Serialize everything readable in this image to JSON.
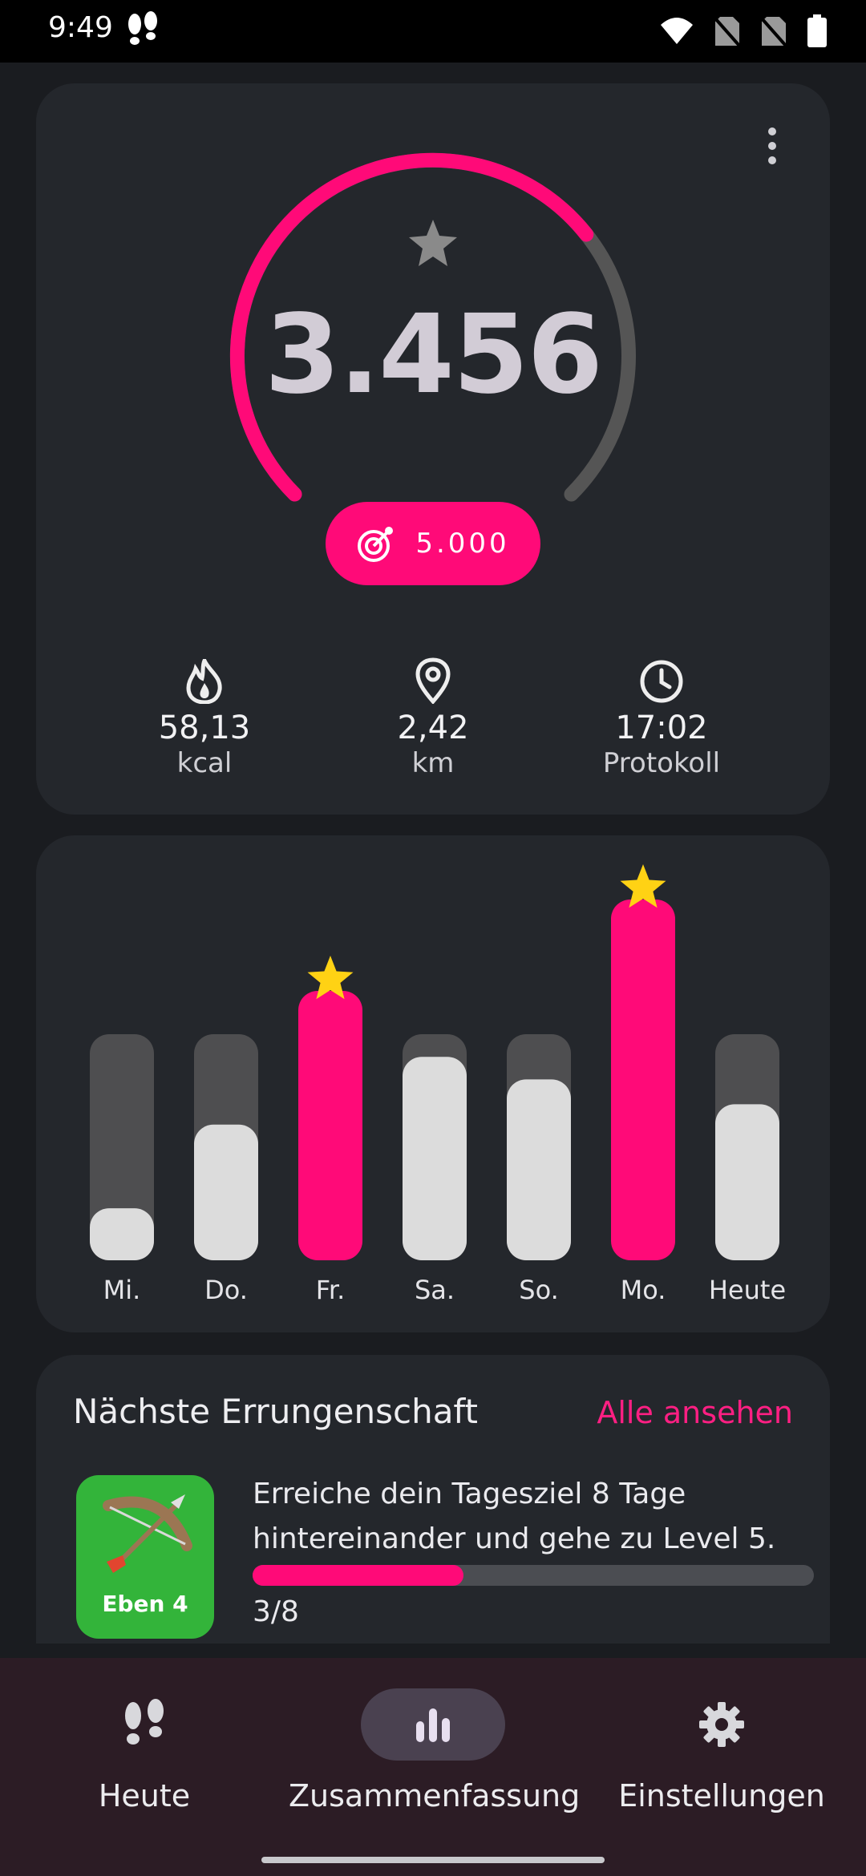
{
  "status_bar": {
    "time": "9:49",
    "icons": [
      "steps-notification-icon",
      "wifi-icon",
      "no-sim-icon",
      "no-sim-icon",
      "battery-icon"
    ]
  },
  "summary": {
    "steps": "3.456",
    "goal": "5.000",
    "goal_progress": 0.6912,
    "colors": {
      "accent": "#ff0a78",
      "track": "#555555",
      "star": "#8a8a8a"
    },
    "stats": [
      {
        "icon": "flame-icon",
        "value": "58,13",
        "label": "kcal"
      },
      {
        "icon": "location-pin-icon",
        "value": "2,42",
        "label": "km"
      },
      {
        "icon": "clock-icon",
        "value": "17:02",
        "label": "Protokoll"
      }
    ]
  },
  "weekly": {
    "days": [
      {
        "label": "Mi.",
        "fraction": 0.23,
        "goal_reached": false
      },
      {
        "label": "Do.",
        "fraction": 0.6,
        "goal_reached": false
      },
      {
        "label": "Fr.",
        "fraction": 1.0,
        "goal_reached": true
      },
      {
        "label": "Sa.",
        "fraction": 0.9,
        "goal_reached": false
      },
      {
        "label": "So.",
        "fraction": 0.8,
        "goal_reached": false
      },
      {
        "label": "Mo.",
        "fraction": 1.0,
        "goal_reached": true
      },
      {
        "label": "Heute",
        "fraction": 0.69,
        "goal_reached": false
      }
    ]
  },
  "achievement": {
    "title": "Nächste Errungenschaft",
    "link": "Alle ansehen",
    "badge_label": "Eben 4",
    "description": "Erreiche dein Tagesziel 8 Tage hintereinander und gehe zu Level 5.",
    "progress_text": "3/8",
    "progress": 0.375
  },
  "nav": {
    "items": [
      {
        "label": "Heute",
        "icon": "footsteps-icon",
        "active": false
      },
      {
        "label": "Zusammenfassung",
        "icon": "bar-chart-icon",
        "active": true
      },
      {
        "label": "Einstellungen",
        "icon": "gear-icon",
        "active": false
      }
    ]
  }
}
